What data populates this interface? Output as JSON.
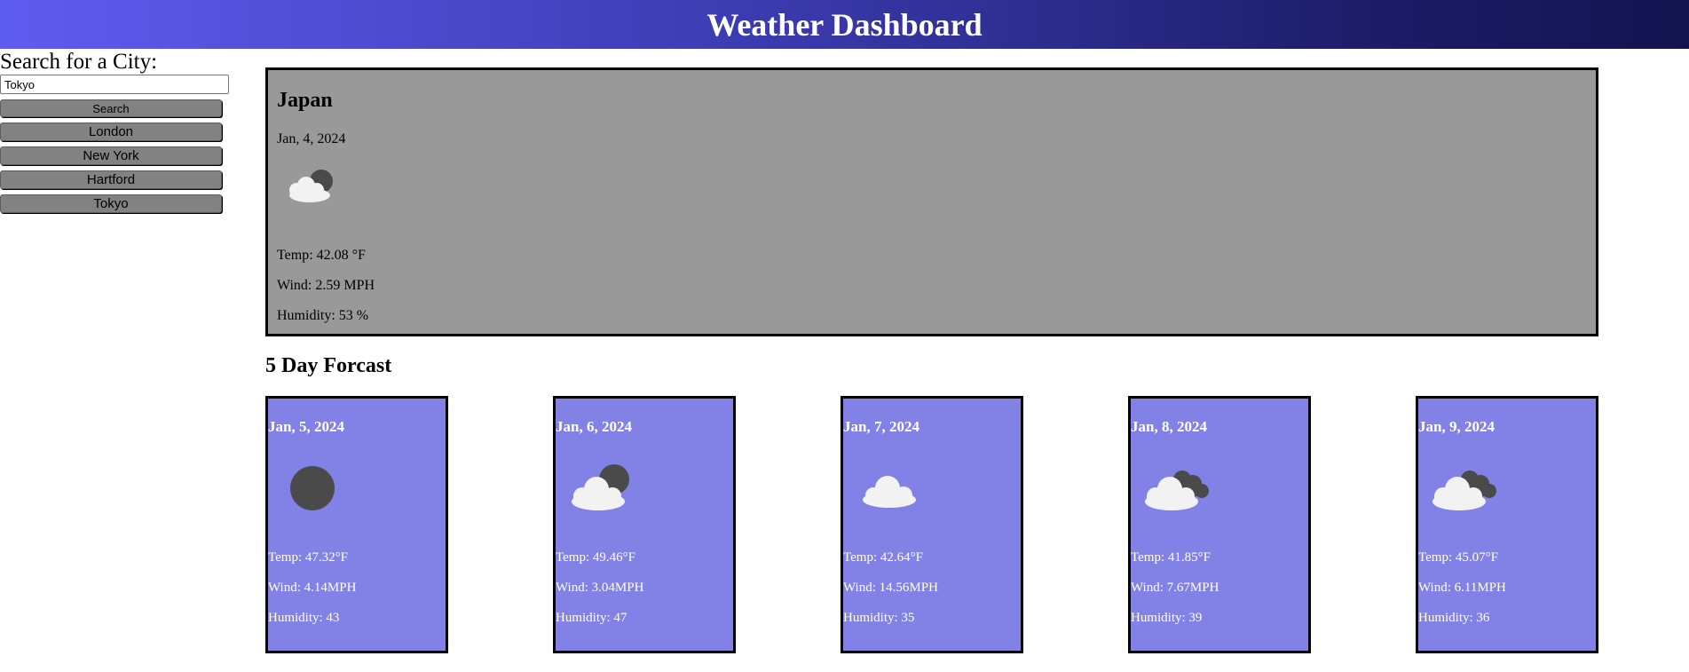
{
  "header": {
    "title": "Weather Dashboard"
  },
  "sidebar": {
    "label": "Search for a City:",
    "input_value": "Tokyo",
    "search_label": "Search",
    "history": [
      "London",
      "New York",
      "Hartford",
      "Tokyo"
    ]
  },
  "current": {
    "city": "Japan",
    "date": "Jan, 4, 2024",
    "icon": "partly-cloudy-night-icon",
    "temp": "Temp: 42.08 °F",
    "wind": "Wind: 2.59 MPH",
    "humidity": "Humidity: 53 %"
  },
  "forecast": {
    "title": "5 Day Forcast",
    "days": [
      {
        "date": "Jan, 5, 2024",
        "icon": "clear-night-icon",
        "temp": "Temp: 47.32°F",
        "wind": "Wind: 4.14MPH",
        "humidity": "Humidity: 43"
      },
      {
        "date": "Jan, 6, 2024",
        "icon": "partly-cloudy-night-icon",
        "temp": "Temp: 49.46°F",
        "wind": "Wind: 3.04MPH",
        "humidity": "Humidity: 47"
      },
      {
        "date": "Jan, 7, 2024",
        "icon": "cloud-icon",
        "temp": "Temp: 42.64°F",
        "wind": "Wind: 14.56MPH",
        "humidity": "Humidity: 35"
      },
      {
        "date": "Jan, 8, 2024",
        "icon": "broken-clouds-icon",
        "temp": "Temp: 41.85°F",
        "wind": "Wind: 7.67MPH",
        "humidity": "Humidity: 39"
      },
      {
        "date": "Jan, 9, 2024",
        "icon": "broken-clouds-icon",
        "temp": "Temp: 45.07°F",
        "wind": "Wind: 6.11MPH",
        "humidity": "Humidity: 36"
      }
    ]
  },
  "colors": {
    "header_start": "#5f5cf0",
    "header_end": "#131350",
    "current_bg": "#999999",
    "card_bg": "#8282e6",
    "button_bg": "#828282"
  }
}
